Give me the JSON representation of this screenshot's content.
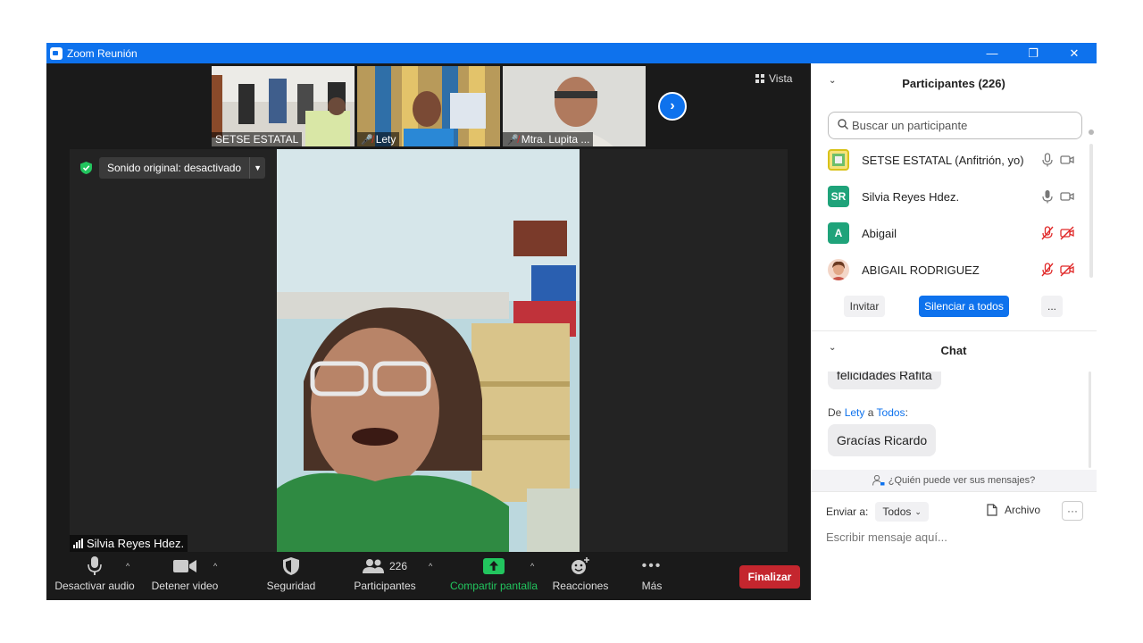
{
  "window": {
    "title": "Zoom Reunión",
    "controls": [
      "—",
      "❐",
      "✕"
    ]
  },
  "thumbnails": [
    {
      "name": "SETSE ESTATAL",
      "muted": false
    },
    {
      "name": "Lety",
      "muted": true
    },
    {
      "name": "Mtra. Lupita ...",
      "muted": true
    }
  ],
  "vista_label": "Vista",
  "sound_original": "Sonido original: desactivado",
  "active_speaker": "Silvia Reyes Hdez.",
  "toolbar": {
    "audio": "Desactivar audio",
    "video": "Detener video",
    "security": "Seguridad",
    "participants": "Participantes",
    "participants_count": "226",
    "share": "Compartir pantalla",
    "reactions": "Reacciones",
    "more": "Más",
    "end": "Finalizar"
  },
  "participants_panel": {
    "title": "Participantes (226)",
    "search_placeholder": "Buscar un participante",
    "list": [
      {
        "initials": "",
        "name": "SETSE ESTATAL (Anfitrión, yo)",
        "muted": false
      },
      {
        "initials": "SR",
        "name": "Silvia Reyes Hdez.",
        "muted": false
      },
      {
        "initials": "A",
        "name": "Abigail",
        "muted": true
      },
      {
        "initials": "",
        "name": "ABIGAIL RODRIGUEZ",
        "muted": true
      }
    ],
    "invite": "Invitar",
    "mute_all": "Silenciar a todos",
    "more": "..."
  },
  "chat": {
    "title": "Chat",
    "messages": [
      {
        "text": "felicidades Rafita"
      },
      {
        "from_prefix": "De",
        "from": "Lety",
        "to_prefix": "a",
        "to": "Todos",
        "to_suffix": ":",
        "text": "Gracías Ricardo"
      }
    ],
    "who_sees": "¿Quién puede ver sus mensajes?",
    "send_to_label": "Enviar a:",
    "send_to_value": "Todos",
    "file": "Archivo",
    "more": "···",
    "compose_placeholder": "Escribir mensaje aquí..."
  },
  "colors": {
    "accent": "#0e72ed",
    "end": "#c4262e",
    "share": "#22c55e",
    "muted": "#e02828"
  }
}
